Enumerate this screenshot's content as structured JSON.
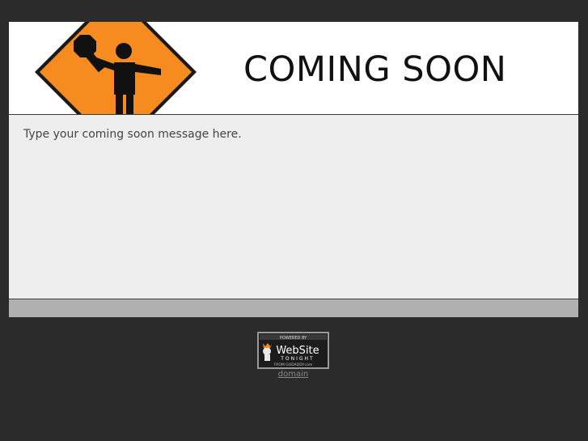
{
  "header": {
    "title": "COMING SOON"
  },
  "content": {
    "message": "Type your coming soon message here."
  },
  "badge": {
    "line1": "POWERED BY",
    "line2": "WebSite",
    "line3": "TONIGHT",
    "line4": "FROM GODADDY.com"
  },
  "footer": {
    "link": "domain"
  },
  "colors": {
    "background": "#2b2b2b",
    "sign_orange": "#f68b1f",
    "content_bg": "#eeeeee",
    "footer_bar": "#b0b0b0"
  }
}
